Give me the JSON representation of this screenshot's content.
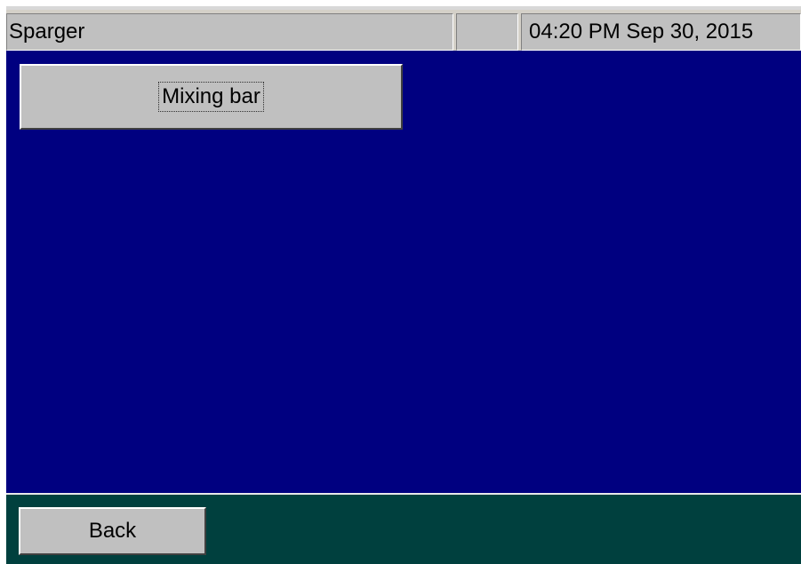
{
  "titlebar": {
    "title": "Sparger",
    "status": "",
    "datetime": "04:20 PM Sep 30, 2015"
  },
  "main": {
    "buttons": [
      {
        "label": "Mixing bar"
      }
    ]
  },
  "footer": {
    "back_label": "Back"
  },
  "colors": {
    "main_background": "#000080",
    "footer_background": "#00403e",
    "button_face": "#c0c0c0"
  }
}
